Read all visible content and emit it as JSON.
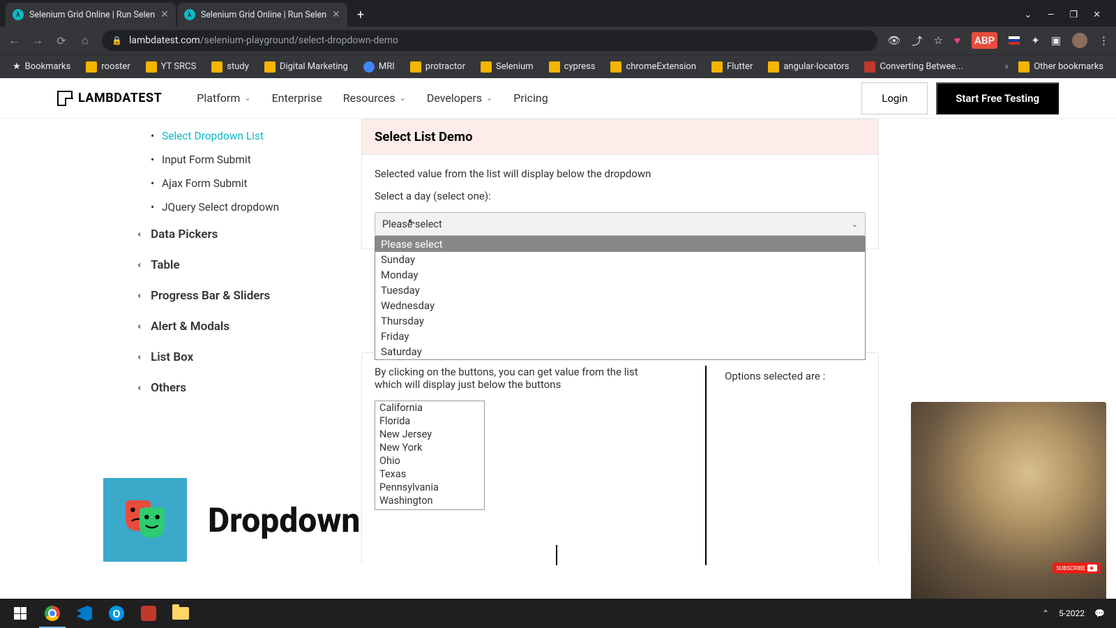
{
  "browser": {
    "tabs": [
      {
        "title": "Selenium Grid Online | Run Selen"
      },
      {
        "title": "Selenium Grid Online | Run Selen"
      }
    ],
    "url_domain": "lambdatest.com",
    "url_path": "/selenium-playground/select-dropdown-demo",
    "bookmarks": [
      "Bookmarks",
      "rooster",
      "YT SRCS",
      "study",
      "Digital Marketing",
      "MRI",
      "protractor",
      "Selenium",
      "cypress",
      "chromeExtension",
      "Flutter",
      "angular-locators",
      "Converting Betwee..."
    ],
    "other_bookmarks": "Other bookmarks"
  },
  "header": {
    "logo": "LAMBDATEST",
    "nav": [
      "Platform",
      "Enterprise",
      "Resources",
      "Developers",
      "Pricing"
    ],
    "login": "Login",
    "cta": "Start Free Testing"
  },
  "sidebar": {
    "items": [
      {
        "label": "Select Dropdown List",
        "type": "sub",
        "active": true
      },
      {
        "label": "Input Form Submit",
        "type": "sub"
      },
      {
        "label": "Ajax Form Submit",
        "type": "sub"
      },
      {
        "label": "JQuery Select dropdown",
        "type": "sub"
      },
      {
        "label": "Data Pickers",
        "type": "section"
      },
      {
        "label": "Table",
        "type": "section"
      },
      {
        "label": "Progress Bar & Sliders",
        "type": "section"
      },
      {
        "label": "Alert & Modals",
        "type": "section"
      },
      {
        "label": "List Box",
        "type": "section"
      },
      {
        "label": "Others",
        "type": "section"
      }
    ]
  },
  "demo": {
    "title": "Select List Demo",
    "desc": "Selected value from the list will display below the dropdown",
    "label": "Select a day (select one):",
    "selected": "Please select",
    "options": [
      "Please select",
      "Sunday",
      "Monday",
      "Tuesday",
      "Wednesday",
      "Thursday",
      "Friday",
      "Saturday"
    ],
    "multi_instr1": "By clicking on the buttons, you can get value from the list",
    "multi_instr2": "which will display just below the buttons",
    "multi_options": [
      "California",
      "Florida",
      "New Jersey",
      "New York",
      "Ohio",
      "Texas",
      "Pennsylvania",
      "Washington"
    ],
    "result_label": "Options selected are :"
  },
  "overlay": {
    "text": "Dropdown"
  },
  "taskbar": {
    "time": "5-2022"
  }
}
